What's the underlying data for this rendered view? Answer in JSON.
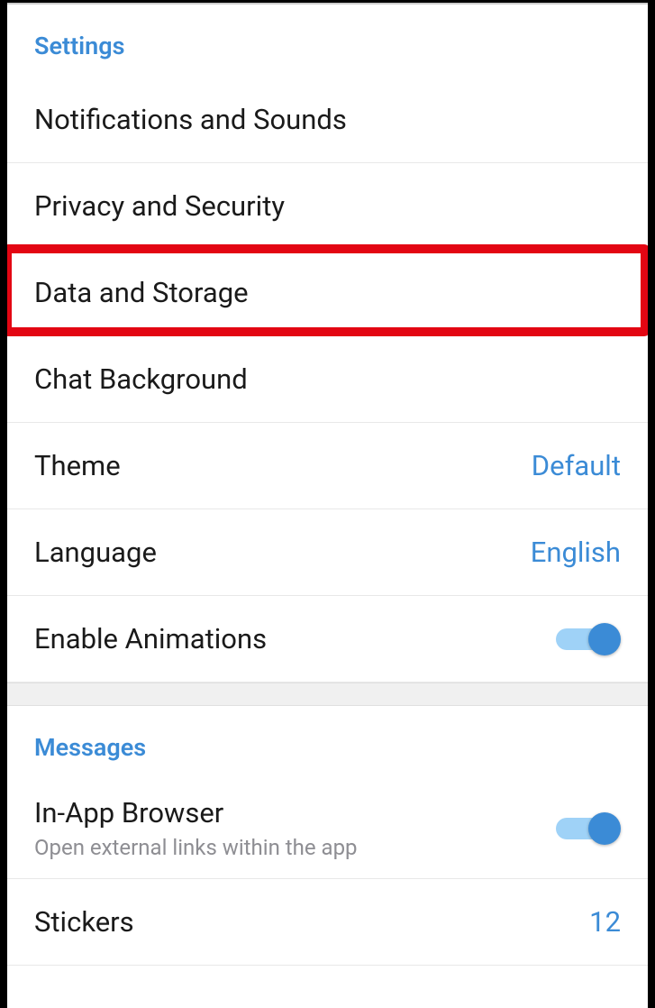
{
  "settings": {
    "header": "Settings",
    "items": [
      {
        "label": "Notifications and Sounds"
      },
      {
        "label": "Privacy and Security"
      },
      {
        "label": "Data and Storage"
      },
      {
        "label": "Chat Background"
      },
      {
        "label": "Theme",
        "value": "Default"
      },
      {
        "label": "Language",
        "value": "English"
      },
      {
        "label": "Enable Animations",
        "toggle": true
      }
    ]
  },
  "messages": {
    "header": "Messages",
    "items": [
      {
        "label": "In-App Browser",
        "subtext": "Open external links within the app",
        "toggle": true
      },
      {
        "label": "Stickers",
        "value": "12"
      }
    ]
  }
}
